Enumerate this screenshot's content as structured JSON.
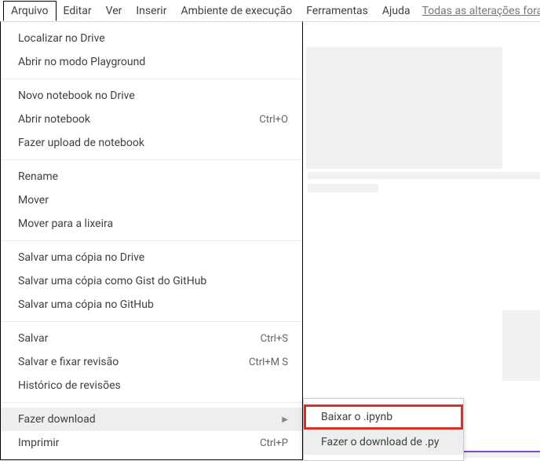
{
  "menubar": {
    "items": [
      {
        "label": "Arquivo"
      },
      {
        "label": "Editar"
      },
      {
        "label": "Ver"
      },
      {
        "label": "Inserir"
      },
      {
        "label": "Ambiente de execução"
      },
      {
        "label": "Ferramentas"
      },
      {
        "label": "Ajuda"
      }
    ],
    "status": "Todas as alterações fora"
  },
  "dropdown": {
    "items": [
      {
        "label": "Localizar no Drive"
      },
      {
        "label": "Abrir no modo Playground"
      }
    ],
    "items2": [
      {
        "label": "Novo notebook no Drive"
      },
      {
        "label": "Abrir notebook",
        "shortcut": "Ctrl+O"
      },
      {
        "label": "Fazer upload de notebook"
      }
    ],
    "items3": [
      {
        "label": "Rename"
      },
      {
        "label": "Mover"
      },
      {
        "label": "Mover para a lixeira"
      }
    ],
    "items4": [
      {
        "label": "Salvar uma cópia no Drive"
      },
      {
        "label": "Salvar uma cópia como Gist do GitHub"
      },
      {
        "label": "Salvar uma cópia no GitHub"
      }
    ],
    "items5": [
      {
        "label": "Salvar",
        "shortcut": "Ctrl+S"
      },
      {
        "label": "Salvar e fixar revisão",
        "shortcut": "Ctrl+M S"
      },
      {
        "label": "Histórico de revisões"
      }
    ],
    "items6": [
      {
        "label": "Fazer download"
      },
      {
        "label": "Imprimir",
        "shortcut": "Ctrl+P"
      }
    ]
  },
  "submenu": {
    "items": [
      {
        "label": "Baixar o .ipynb"
      },
      {
        "label": "Fazer o download de .py"
      }
    ]
  }
}
